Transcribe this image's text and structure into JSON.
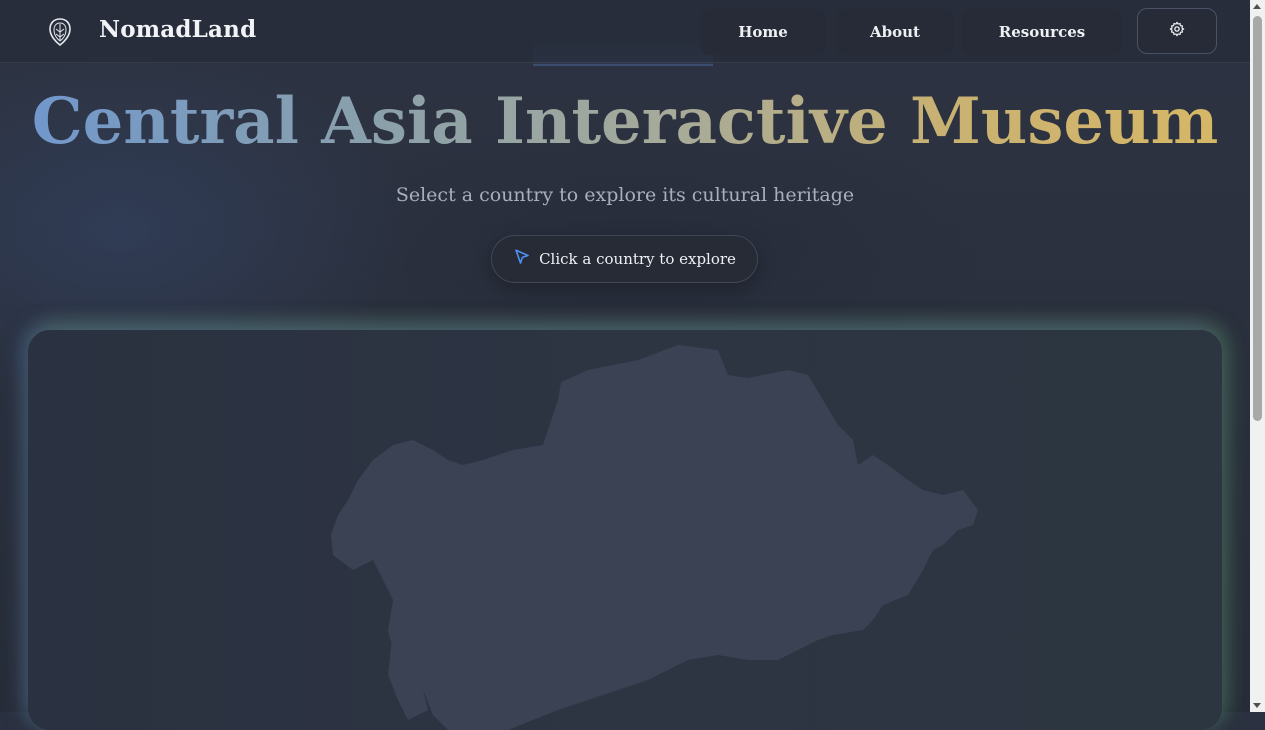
{
  "brand": {
    "name": "NomadLand",
    "logo_icon": "shield-leaf-icon"
  },
  "nav": {
    "items": [
      {
        "label": "Home"
      },
      {
        "label": "About"
      },
      {
        "label": "Resources"
      }
    ],
    "settings_icon": "gear-icon"
  },
  "hero": {
    "title": "Central Asia Interactive Museum",
    "subtitle": "Select a country to explore its cultural heritage",
    "cta_label": "Click a country to explore",
    "cta_icon": "cursor-arrow-icon"
  },
  "colors": {
    "title_gradient_start": "#6f97cf",
    "title_gradient_end": "#d8b865",
    "map_fill": "#3a4254",
    "background": "#2b3140",
    "cta_icon": "#4d8ff0"
  }
}
